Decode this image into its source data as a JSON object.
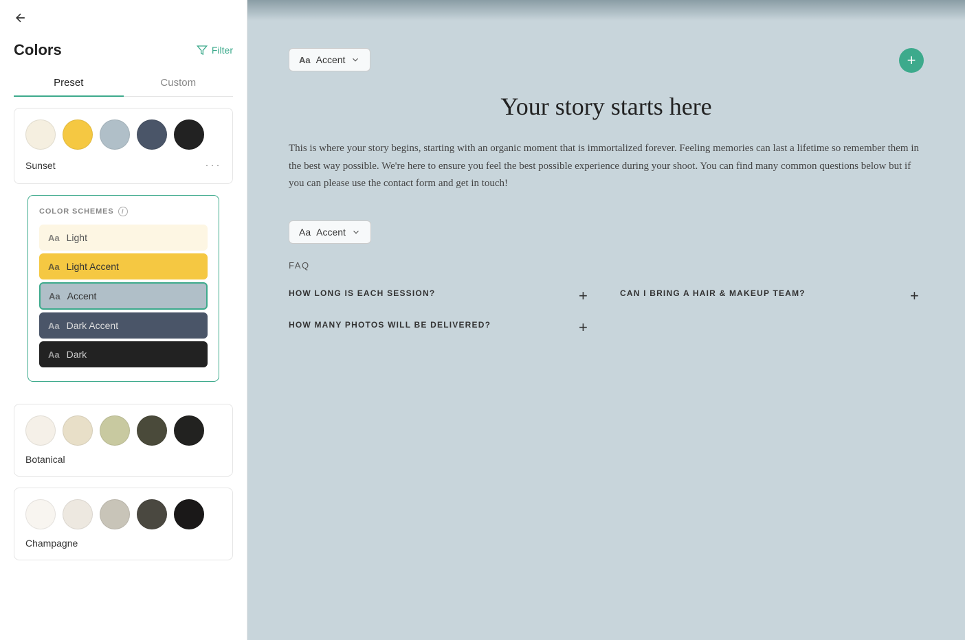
{
  "panel": {
    "back_label": "←",
    "title": "Colors",
    "filter_label": "Filter",
    "tabs": [
      {
        "id": "preset",
        "label": "Preset",
        "active": true
      },
      {
        "id": "custom",
        "label": "Custom",
        "active": false
      }
    ],
    "presets": [
      {
        "id": "sunset",
        "name": "Sunset",
        "swatches": [
          "#f5efe0",
          "#f5c842",
          "#b0bfc8",
          "#4a5568",
          "#222222"
        ],
        "selected": true
      },
      {
        "id": "botanical",
        "name": "Botanical",
        "swatches": [
          "#f5f0e8",
          "#e8dfc8",
          "#c8c9a0",
          "#4a4a3a",
          "#222220"
        ]
      },
      {
        "id": "champagne",
        "name": "Champagne",
        "swatches": [
          "#f8f5f0",
          "#ede8e0",
          "#c8c4b8",
          "#4a4840",
          "#1a1818"
        ]
      }
    ],
    "color_schemes_label": "COLOR SCHEMES",
    "schemes": [
      {
        "id": "light",
        "label": "Light",
        "bg": "#fdf6e3",
        "text": "#555"
      },
      {
        "id": "light-accent",
        "label": "Light Accent",
        "bg": "#f5c842",
        "text": "#333"
      },
      {
        "id": "accent",
        "label": "Accent",
        "bg": "#b0bfc8",
        "text": "#333",
        "selected": true
      },
      {
        "id": "dark-accent",
        "label": "Dark Accent",
        "bg": "#4a5568",
        "text": "#ddd"
      },
      {
        "id": "dark",
        "label": "Dark",
        "bg": "#222222",
        "text": "#ccc"
      }
    ]
  },
  "main": {
    "accent_label": "Accent",
    "accent_label_2": "Accent",
    "add_section_label": "+",
    "story_title": "Your story starts here",
    "story_body": "This is where your story begins, starting with an organic moment that is immortalized forever. Feeling memories can last a lifetime so remember them in the best way possible. We're here to ensure you feel the best possible experience during your shoot. You can find many common questions below but if you can please use the contact form and get in touch!",
    "faq_label": "FAQ",
    "faq_items": [
      {
        "question": "HOW LONG IS EACH SESSION?"
      },
      {
        "question": "CAN I BRING A HAIR & MAKEUP TEAM?"
      },
      {
        "question": "HOW MANY PHOTOS WILL BE DELIVERED?"
      }
    ]
  }
}
